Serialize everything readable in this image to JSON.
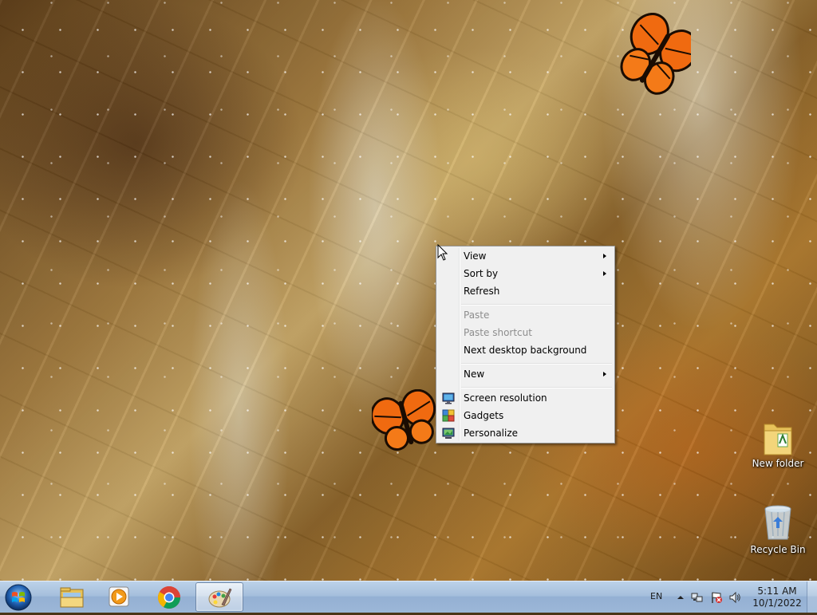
{
  "desktop": {
    "icons": [
      {
        "label": "New folder",
        "icon": "folder-icon"
      },
      {
        "label": "Recycle Bin",
        "icon": "recycle-bin-icon"
      }
    ]
  },
  "context_menu": {
    "items": [
      {
        "label": "View",
        "submenu": true,
        "enabled": true
      },
      {
        "label": "Sort by",
        "submenu": true,
        "enabled": true
      },
      {
        "label": "Refresh",
        "submenu": false,
        "enabled": true
      },
      {
        "label": "Paste",
        "submenu": false,
        "enabled": false
      },
      {
        "label": "Paste shortcut",
        "submenu": false,
        "enabled": false
      },
      {
        "label": "Next desktop background",
        "submenu": false,
        "enabled": true
      },
      {
        "label": "New",
        "submenu": true,
        "enabled": true
      },
      {
        "label": "Screen resolution",
        "submenu": false,
        "enabled": true,
        "icon": "screen-resolution-icon"
      },
      {
        "label": "Gadgets",
        "submenu": false,
        "enabled": true,
        "icon": "gadgets-icon"
      },
      {
        "label": "Personalize",
        "submenu": false,
        "enabled": true,
        "icon": "personalize-icon"
      }
    ]
  },
  "taskbar": {
    "start_icon": "windows-orb-icon",
    "pinned": [
      {
        "name": "Windows Explorer",
        "icon": "explorer-folder-icon",
        "active": false
      },
      {
        "name": "Windows Media Player",
        "icon": "media-player-icon",
        "active": false
      },
      {
        "name": "Google Chrome",
        "icon": "chrome-icon",
        "active": false
      },
      {
        "name": "Paint",
        "icon": "paint-icon",
        "active": true
      }
    ],
    "tray": {
      "language": "EN",
      "icons": [
        "show-hidden-icons-chevron-icon",
        "network-icon",
        "action-center-flag-icon",
        "volume-icon"
      ],
      "time": "5:11 AM",
      "date": "10/1/2022"
    }
  },
  "colors": {
    "menu_background": "#f0f0f0",
    "menu_disabled_text": "#8d8d8d",
    "taskbar_top": "#bcd2e9",
    "taskbar_bottom": "#9cb7d8"
  }
}
